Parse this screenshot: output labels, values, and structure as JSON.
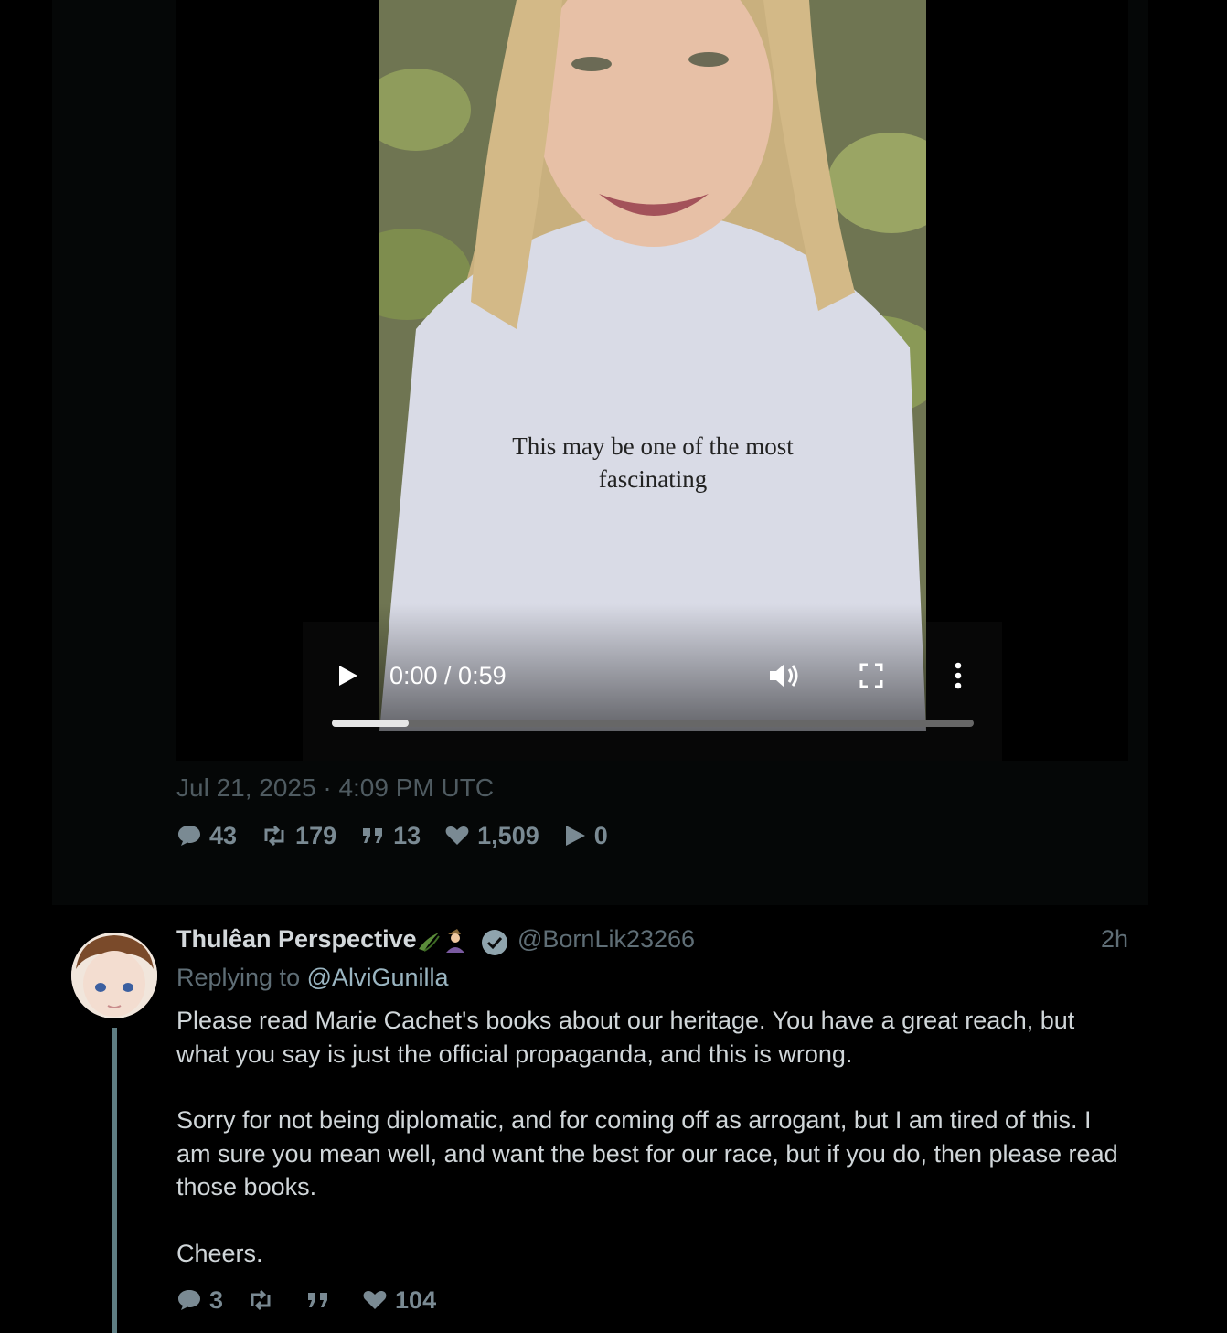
{
  "video": {
    "caption_line1": "This may be one of the most",
    "caption_line2": "fascinating",
    "time_display": "0:00 / 0:59",
    "progress_fraction": 0.12,
    "icons": [
      "play-icon",
      "volume-icon",
      "fullscreen-icon",
      "more-options-icon"
    ]
  },
  "tweet": {
    "timestamp": "Jul 21, 2025 · 4:09 PM UTC",
    "stats": {
      "replies": "43",
      "retweets": "179",
      "quotes": "13",
      "likes": "1,509",
      "plays": "0"
    }
  },
  "reply": {
    "display_name": "Thulêan Perspective",
    "handle": "@BornLik23266",
    "time_ago": "2h",
    "replying_prefix": "Replying to",
    "replying_to": "@AlviGunilla",
    "paragraphs": [
      "Please read Marie Cachet's books about our heritage. You have a great reach, but what you say is just the official propaganda, and this is wrong.",
      "Sorry for not being diplomatic, and for coming off as arrogant, but I am tired of this. I am sure you mean well, and want the best for our race, but if you do, then please read those books.",
      "Cheers."
    ],
    "stats": {
      "replies": "3",
      "likes": "104"
    }
  },
  "colors": {
    "background": "#000000",
    "muted_text": "#5f6e76",
    "stat_text": "#7a8a93",
    "link": "#9ab5c1",
    "thread_line": "#5e7d83"
  }
}
